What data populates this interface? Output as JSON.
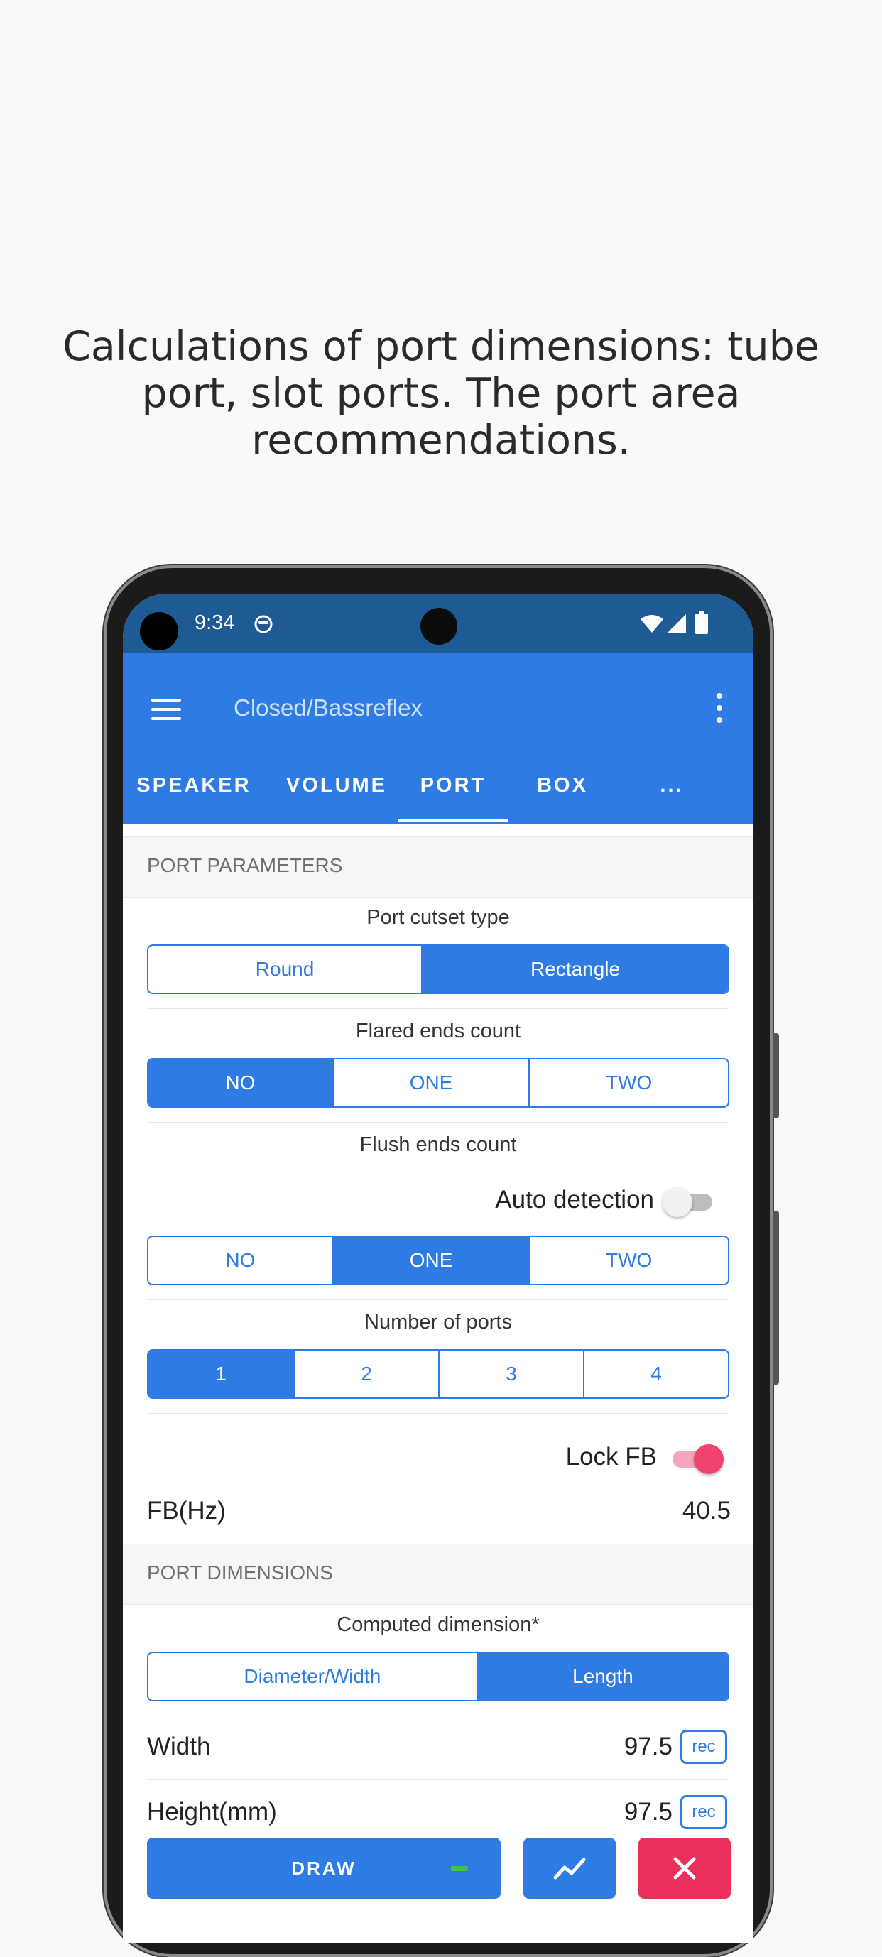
{
  "headline": "Calculations of port dimensions: tube port, slot ports. The port area recommendations.",
  "status_bar": {
    "time": "9:34"
  },
  "app_bar": {
    "title": "Closed/Bassreflex"
  },
  "tabs": [
    {
      "label": "SPEAKER"
    },
    {
      "label": "VOLUME"
    },
    {
      "label": "PORT"
    },
    {
      "label": "BOX"
    },
    {
      "label": "..."
    }
  ],
  "port_parameters": {
    "header": "PORT PARAMETERS",
    "cutset": {
      "caption": "Port cutset type",
      "options": [
        "Round",
        "Rectangle"
      ],
      "selected": "Rectangle"
    },
    "flared": {
      "caption": "Flared ends count",
      "options": [
        "NO",
        "ONE",
        "TWO"
      ],
      "selected": "NO"
    },
    "flush": {
      "caption": "Flush ends count",
      "options": [
        "NO",
        "ONE",
        "TWO"
      ],
      "selected": "ONE"
    },
    "auto_detection": {
      "label": "Auto detection",
      "on": false
    },
    "ports": {
      "caption": "Number of ports",
      "options": [
        "1",
        "2",
        "3",
        "4"
      ],
      "selected": "1"
    },
    "lock_fb": {
      "label": "Lock FB",
      "on": true
    },
    "fb": {
      "label": "FB(Hz)",
      "value": "40.5"
    }
  },
  "port_dimensions": {
    "header": "PORT DIMENSIONS",
    "computed": {
      "caption": "Computed dimension*",
      "options": [
        "Diameter/Width",
        "Length"
      ],
      "selected": "Length"
    },
    "width": {
      "label": "Width",
      "value": "97.5",
      "rec": "rec"
    },
    "height": {
      "label": "Height(mm)",
      "value": "97.5",
      "rec": "rec"
    }
  },
  "actions": {
    "draw": "DRAW"
  },
  "colors": {
    "primary": "#2e7be3",
    "status_bar": "#1e5b94",
    "accent": "#f0426e",
    "danger": "#e8305a"
  }
}
